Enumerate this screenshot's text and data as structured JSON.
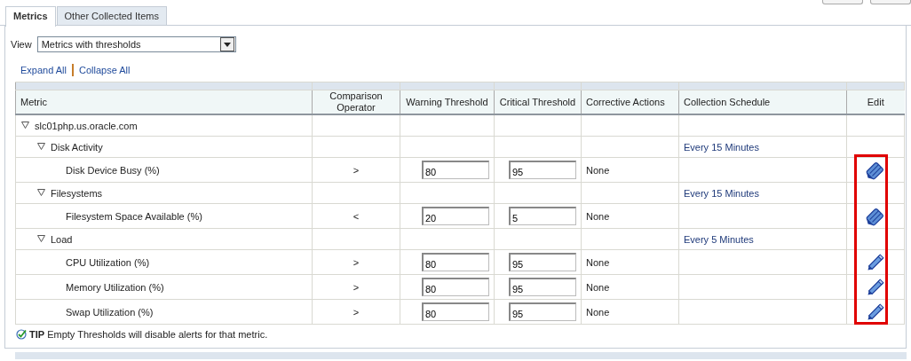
{
  "tabs": [
    {
      "label": "Metrics",
      "selected": true
    },
    {
      "label": "Other Collected Items",
      "selected": false
    }
  ],
  "view": {
    "label": "View",
    "value": "Metrics with thresholds"
  },
  "links": [
    "Expand All",
    "Collapse All"
  ],
  "table": {
    "columns": [
      "Metric",
      "Comparison Operator",
      "Warning Threshold",
      "Critical Threshold",
      "Corrective Actions",
      "Collection Schedule",
      "Edit"
    ],
    "edit_column_highlighted": true,
    "rows": [
      {
        "name": "slc01php.us.oracle.com",
        "expanded": true,
        "children": [
          {
            "name": "Disk Activity",
            "expanded": true,
            "schedule": "Every 15 Minutes",
            "children": [
              {
                "name": "Disk Device Busy (%)",
                "operator": ">",
                "warning": "80",
                "critical": "95",
                "actions": "None",
                "edit": {
                  "kind": "multi"
                }
              }
            ]
          },
          {
            "name": "Filesystems",
            "expanded": true,
            "schedule": "Every 15 Minutes",
            "children": [
              {
                "name": "Filesystem Space Available (%)",
                "operator": "<",
                "warning": "20",
                "critical": "5",
                "actions": "None",
                "edit": {
                  "kind": "multi"
                }
              }
            ]
          },
          {
            "name": "Load",
            "expanded": true,
            "schedule": "Every 5 Minutes",
            "children": [
              {
                "name": "CPU Utilization (%)",
                "operator": ">",
                "warning": "80",
                "critical": "95",
                "actions": "None",
                "edit": {
                  "kind": "single"
                }
              },
              {
                "name": "Memory Utilization (%)",
                "operator": ">",
                "warning": "80",
                "critical": "95",
                "actions": "None",
                "edit": {
                  "kind": "single"
                }
              },
              {
                "name": "Swap Utilization (%)",
                "operator": ">",
                "warning": "80",
                "critical": "95",
                "actions": "None",
                "edit": {
                  "kind": "single"
                }
              }
            ]
          }
        ]
      }
    ]
  },
  "tip": {
    "label": "TIP",
    "text": "Empty Thresholds will disable alerts for that metric."
  }
}
